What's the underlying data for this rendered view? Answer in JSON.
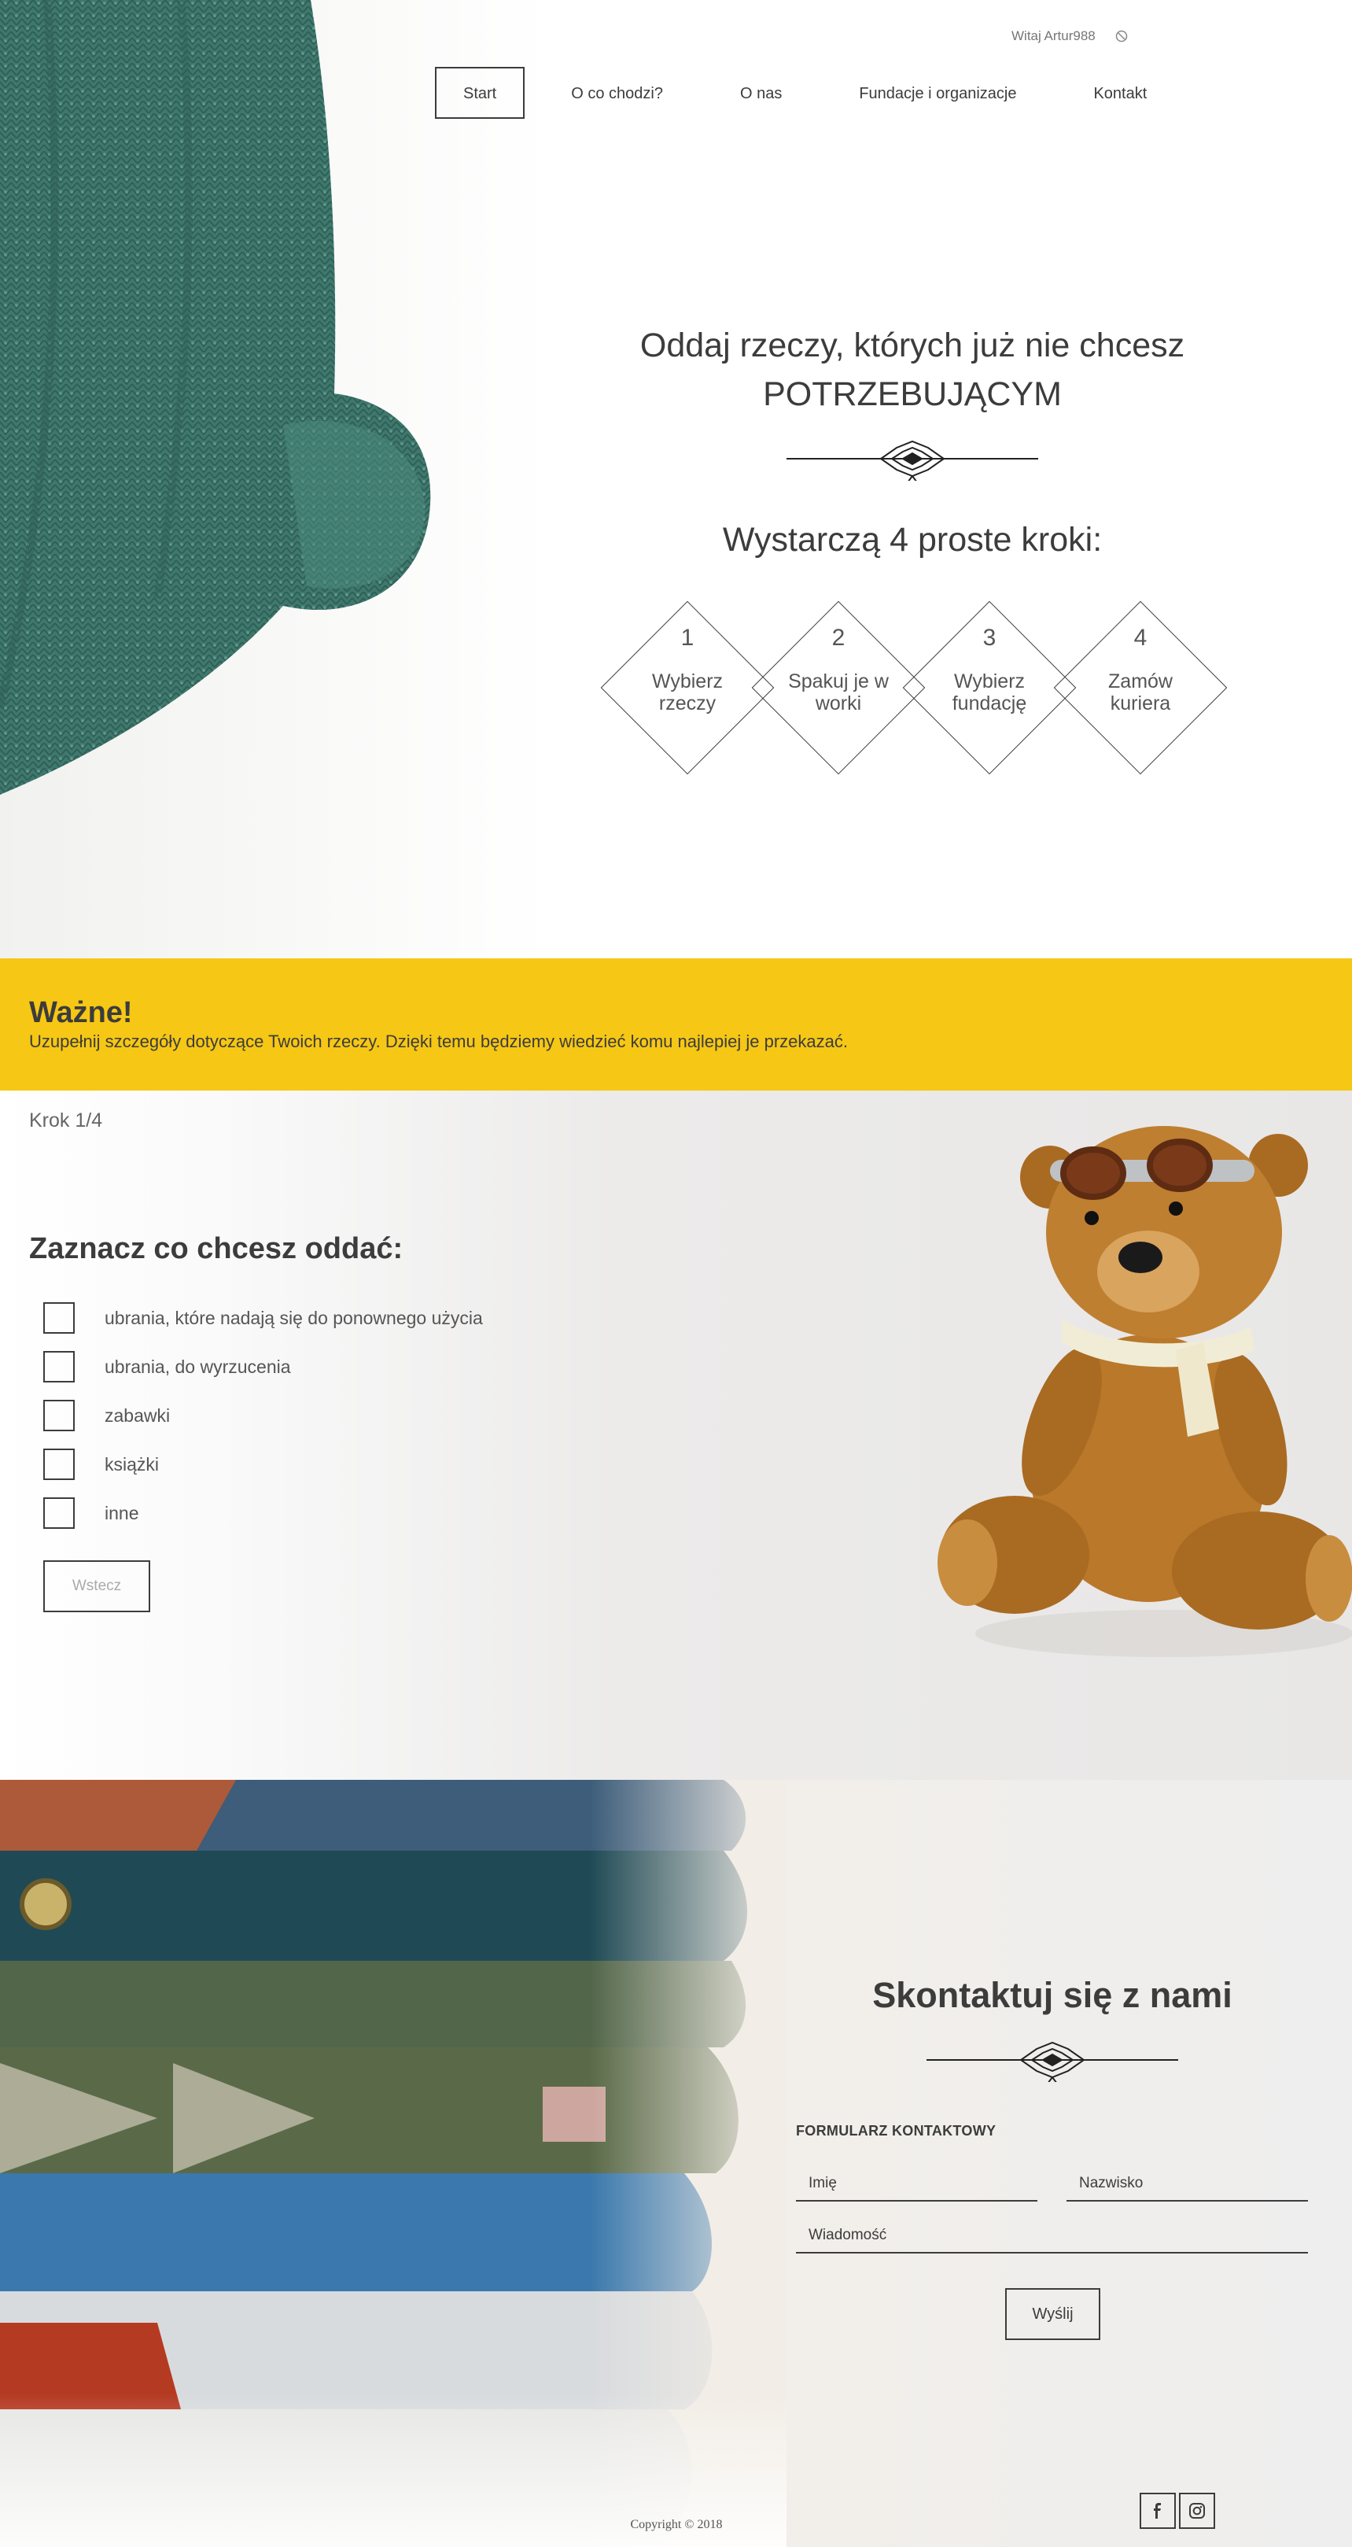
{
  "header": {
    "greeting": "Witaj Artur988",
    "logout_icon": "logout-icon",
    "nav": [
      {
        "label": "Start",
        "active": true
      },
      {
        "label": "O co chodzi?"
      },
      {
        "label": "O nas"
      },
      {
        "label": "Fundacje i organizacje"
      },
      {
        "label": "Kontakt"
      }
    ]
  },
  "hero": {
    "title_line1": "Oddaj rzeczy, których już nie chcesz",
    "title_line2": "POTRZEBUJĄCYM",
    "steps_title": "Wystarczą 4 proste kroki:",
    "steps": [
      {
        "number": "1",
        "label": "Wybierz rzeczy"
      },
      {
        "number": "2",
        "label": "Spakuj je w worki"
      },
      {
        "number": "3",
        "label": "Wybierz fundację"
      },
      {
        "number": "4",
        "label": "Zamów kuriera"
      }
    ]
  },
  "important": {
    "title": "Ważne!",
    "text": "Uzupełnij szczegóły dotyczące Twoich rzeczy. Dzięki temu będziemy wiedzieć komu najlepiej je przekazać."
  },
  "form_step": {
    "counter": "Krok 1/4",
    "title": "Zaznacz co chcesz oddać:",
    "options": [
      "ubrania, które nadają się do ponownego użycia",
      "ubrania, do wyrzucenia",
      "zabawki",
      "książki",
      "inne"
    ],
    "back_label": "Wstecz"
  },
  "contact": {
    "title": "Skontaktuj się z nami",
    "form_label": "FORMULARZ KONTAKTOWY",
    "name_placeholder": "Imię",
    "surname_placeholder": "Nazwisko",
    "message_placeholder": "Wiadomość",
    "send_label": "Wyślij",
    "socials": [
      "facebook-icon",
      "instagram-icon"
    ],
    "copyright": "Copyright © 2018"
  },
  "colors": {
    "accent_yellow": "#f6c714",
    "text_dark": "#3c3c3c",
    "sweater_green": "#3f786d"
  }
}
